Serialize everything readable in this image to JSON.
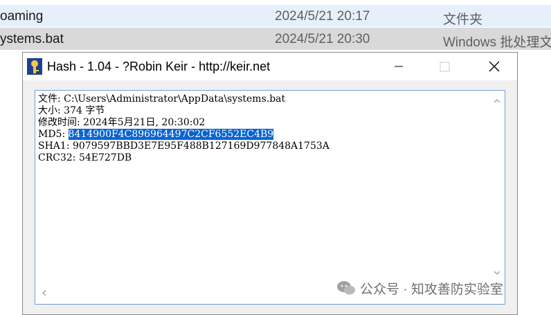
{
  "explorer": {
    "rows": [
      {
        "name": "oaming",
        "date": "2024/5/21 20:17",
        "type": "文件夹"
      },
      {
        "name": "ystems.bat",
        "date": "2024/5/21 20:30",
        "type": "Windows 批处理文"
      }
    ]
  },
  "window": {
    "title": "Hash - 1.04 - ?Robin Keir - http://keir.net",
    "lines": {
      "file": "文件: C:\\Users\\Administrator\\AppData\\systems.bat",
      "size": "大小: 374 字节",
      "modified": "修改时间: 2024年5月21日, 20:30:02",
      "md5_label": "MD5: ",
      "md5_value": "8414900F4C896964497C2CF6552EC4B9",
      "sha1": "SHA1: 9079597BBD3E7E95F488B127169D977848A1753A",
      "crc32": "CRC32: 54E727DB"
    }
  },
  "watermark": {
    "text": "公众号 · 知攻善防实验室"
  },
  "colors": {
    "selection": "#0a64d0",
    "row_selected": "#d9d9d9",
    "row_hover": "#e5f0fb"
  }
}
